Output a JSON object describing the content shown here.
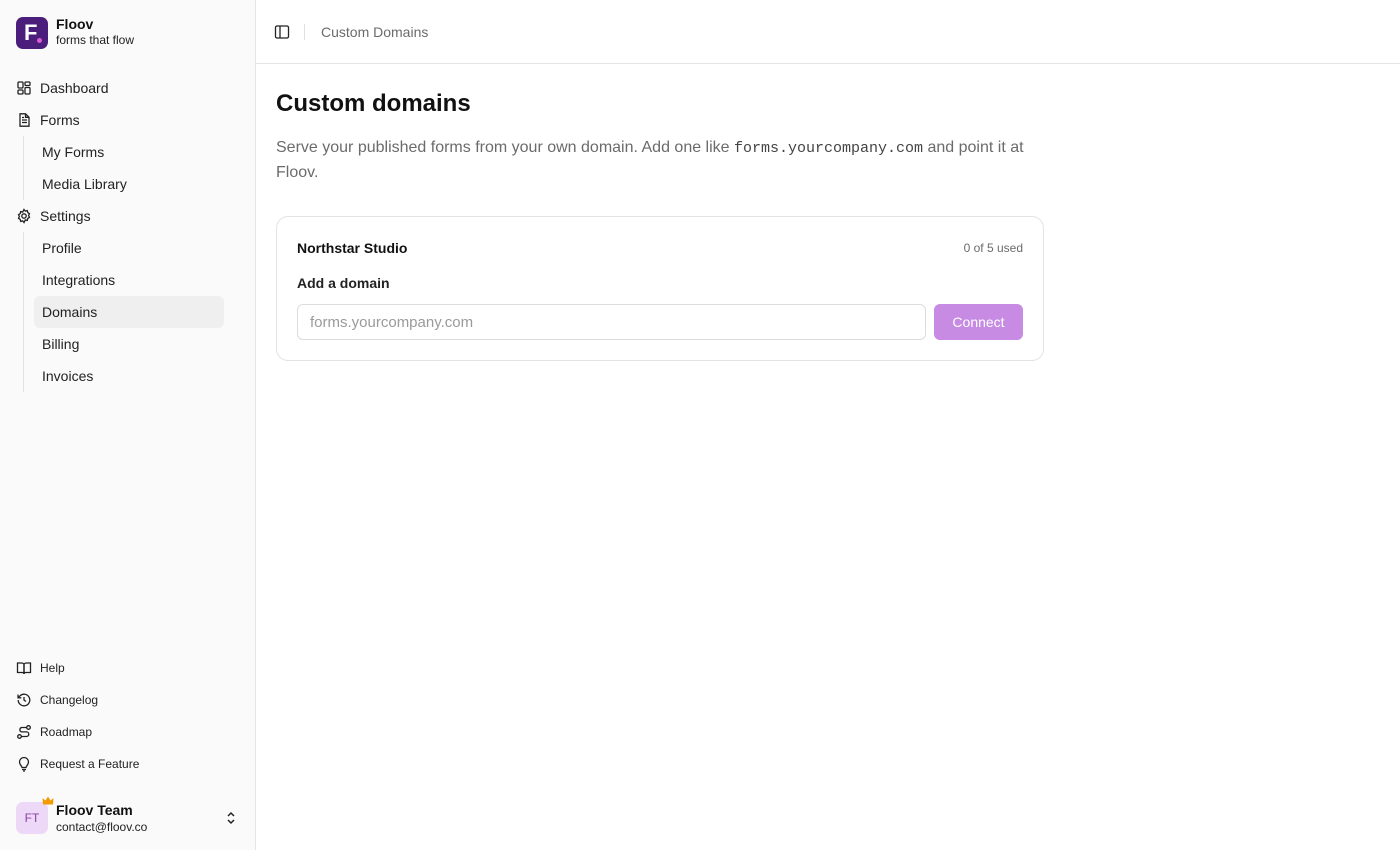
{
  "app": {
    "name": "Floov",
    "tagline": "forms that flow",
    "logo_letter": "F",
    "brand_color": "#4a1e7a",
    "accent_color": "#c78be3"
  },
  "sidebar": {
    "nav": [
      {
        "label": "Dashboard",
        "icon": "dashboard-icon"
      },
      {
        "label": "Forms",
        "icon": "forms-icon",
        "children": [
          {
            "label": "My Forms"
          },
          {
            "label": "Media Library"
          }
        ]
      },
      {
        "label": "Settings",
        "icon": "gear-icon",
        "children": [
          {
            "label": "Profile"
          },
          {
            "label": "Integrations"
          },
          {
            "label": "Domains",
            "active": true
          },
          {
            "label": "Billing"
          },
          {
            "label": "Invoices"
          }
        ]
      }
    ],
    "bottom": [
      {
        "label": "Help",
        "icon": "book-icon"
      },
      {
        "label": "Changelog",
        "icon": "history-icon"
      },
      {
        "label": "Roadmap",
        "icon": "route-icon"
      },
      {
        "label": "Request a Feature",
        "icon": "lightbulb-icon"
      }
    ],
    "user": {
      "initials": "FT",
      "name": "Floov Team",
      "email": "contact@floov.co",
      "badge_icon": "crown-icon"
    }
  },
  "header": {
    "breadcrumb": "Custom Domains"
  },
  "main": {
    "title": "Custom domains",
    "description_before": "Serve your published forms from your own domain. Add one like ",
    "description_code": "forms.yourcompany.com",
    "description_after": " and point it at Floov.",
    "card": {
      "workspace": "Northstar Studio",
      "usage": "0 of 5 used",
      "field_label": "Add a domain",
      "input_placeholder": "forms.yourcompany.com",
      "input_value": "",
      "button_label": "Connect"
    }
  }
}
